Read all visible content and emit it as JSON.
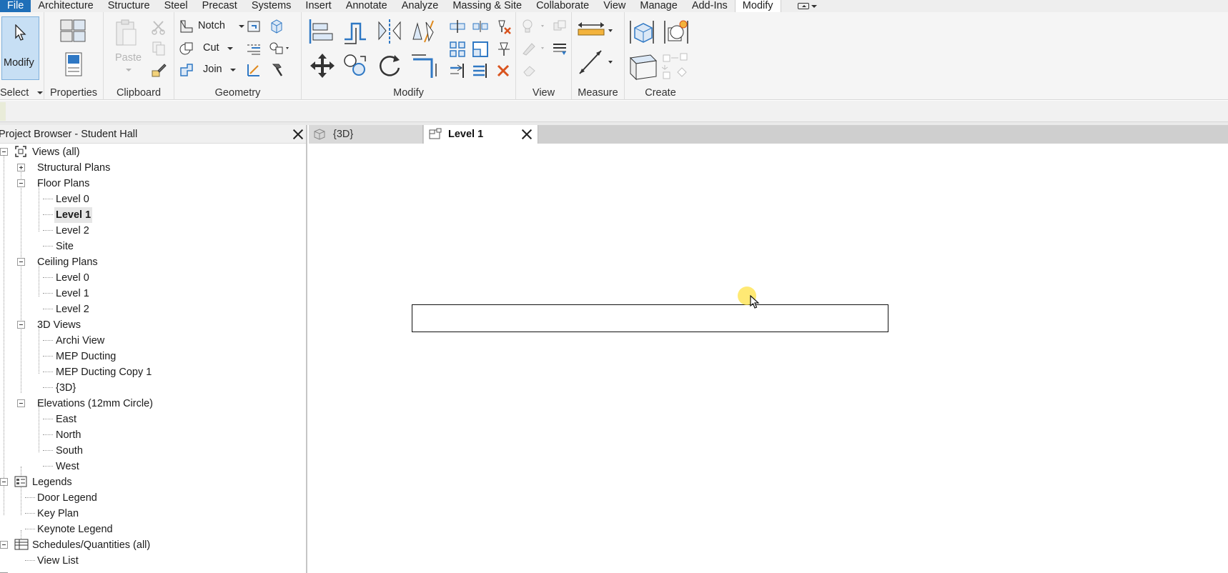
{
  "menubar": {
    "file": "File",
    "tabs": [
      "Architecture",
      "Structure",
      "Steel",
      "Precast",
      "Systems",
      "Insert",
      "Annotate",
      "Analyze",
      "Massing & Site",
      "Collaborate",
      "View",
      "Manage",
      "Add-Ins",
      "Modify"
    ],
    "active_tab": "Modify"
  },
  "ribbon": {
    "modify_label": "Modify",
    "paste_label": "Paste",
    "notch_label": "Notch",
    "cut_label": "Cut",
    "join_label": "Join",
    "panels": {
      "select": "Select",
      "properties": "Properties",
      "clipboard": "Clipboard",
      "geometry": "Geometry",
      "modify": "Modify",
      "view": "View",
      "measure": "Measure",
      "create": "Create"
    }
  },
  "browser": {
    "title": "Project Browser - Student Hall",
    "views_all": "Views (all)",
    "structural_plans": "Structural Plans",
    "floor_plans": "Floor Plans",
    "floor_level0": "Level 0",
    "floor_level1": "Level 1",
    "floor_level2": "Level 2",
    "floor_site": "Site",
    "ceiling_plans": "Ceiling Plans",
    "ceiling_level0": "Level 0",
    "ceiling_level1": "Level 1",
    "ceiling_level2": "Level 2",
    "views_3d": "3D Views",
    "archi_view": "Archi View",
    "mep_ducting": "MEP Ducting",
    "mep_ducting_copy": "MEP Ducting Copy 1",
    "view_3d": "{3D}",
    "elevations": "Elevations (12mm Circle)",
    "east": "East",
    "north": "North",
    "south": "South",
    "west": "West",
    "legends": "Legends",
    "door_legend": "Door Legend",
    "key_plan": "Key Plan",
    "keynote_legend": "Keynote Legend",
    "schedules": "Schedules/Quantities (all)",
    "view_list": "View List"
  },
  "view_tabs": {
    "tab_3d": "{3D}",
    "tab_level1": "Level 1"
  },
  "colors": {
    "file_blue": "#1f6fb8",
    "modify_highlight": "#c7dff4",
    "cursor_halo": "#ffe246"
  }
}
